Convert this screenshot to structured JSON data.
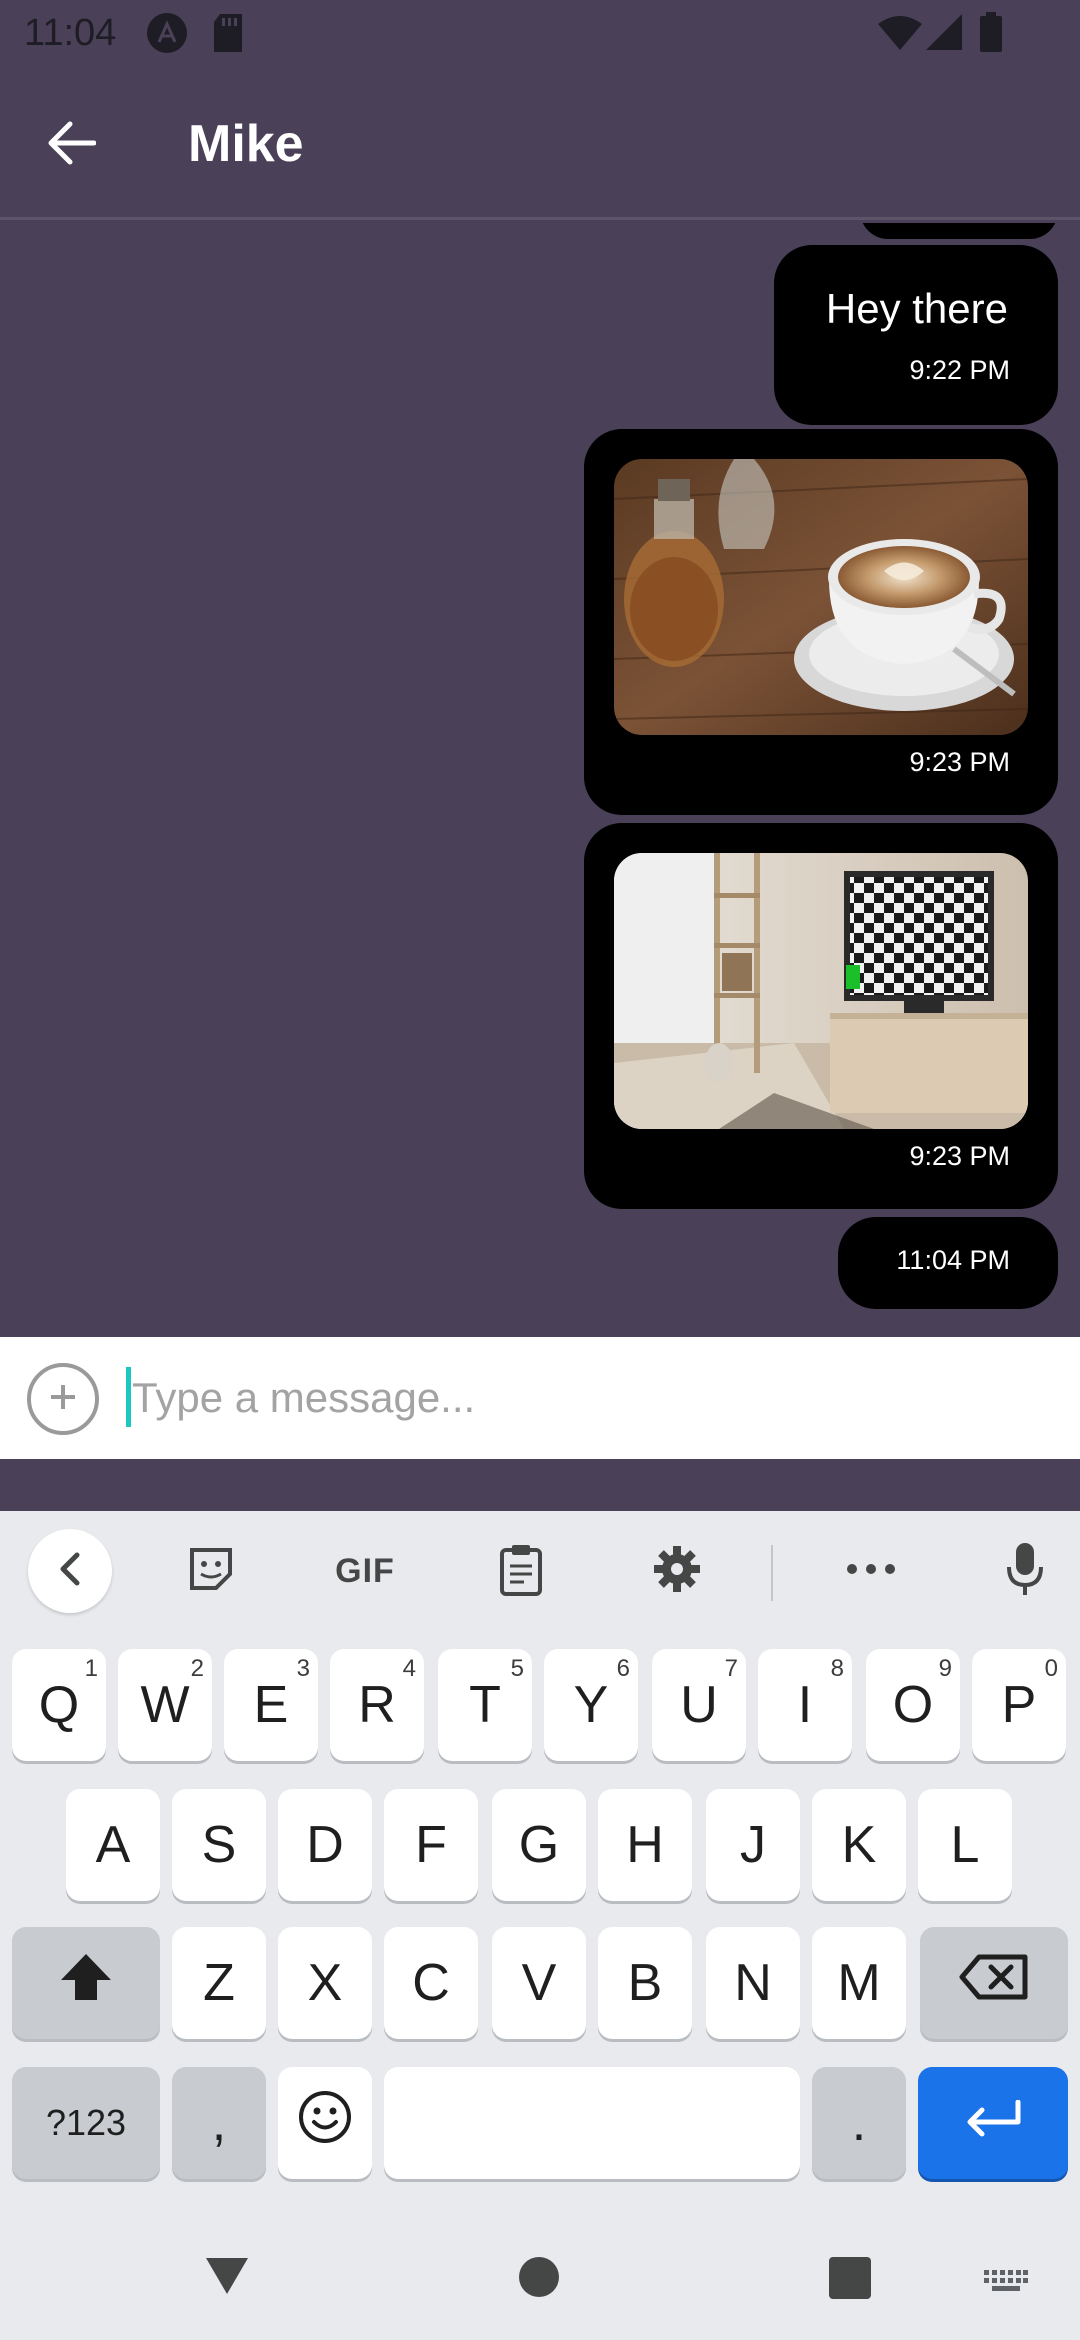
{
  "status_bar": {
    "time": "11:04",
    "icons": [
      "app-notification-icon",
      "sd-card-icon",
      "wifi-icon",
      "signal-icon",
      "battery-icon"
    ]
  },
  "app_bar": {
    "back_icon": "arrow-left-icon",
    "title": "Mike"
  },
  "messages": [
    {
      "type": "text",
      "text": "Hey there",
      "time": "9:22 PM"
    },
    {
      "type": "image",
      "image": "coffee-cup-photo",
      "time": "9:23 PM"
    },
    {
      "type": "image",
      "image": "room-tv-photo",
      "time": "9:23 PM"
    },
    {
      "type": "text",
      "text": "",
      "time": "11:04 PM"
    }
  ],
  "input": {
    "add_icon": "plus-circle-icon",
    "placeholder": "Type a message...",
    "value": ""
  },
  "keyboard": {
    "toolbar": {
      "back_icon": "chevron-left-icon",
      "sticker_icon": "sticker-icon",
      "gif_label": "GIF",
      "clipboard_icon": "clipboard-icon",
      "settings_icon": "gear-icon",
      "more_icon": "more-horizontal-icon",
      "mic_icon": "microphone-icon"
    },
    "row1": [
      {
        "label": "Q",
        "hint": "1"
      },
      {
        "label": "W",
        "hint": "2"
      },
      {
        "label": "E",
        "hint": "3"
      },
      {
        "label": "R",
        "hint": "4"
      },
      {
        "label": "T",
        "hint": "5"
      },
      {
        "label": "Y",
        "hint": "6"
      },
      {
        "label": "U",
        "hint": "7"
      },
      {
        "label": "I",
        "hint": "8"
      },
      {
        "label": "O",
        "hint": "9"
      },
      {
        "label": "P",
        "hint": "0"
      }
    ],
    "row2": [
      "A",
      "S",
      "D",
      "F",
      "G",
      "H",
      "J",
      "K",
      "L"
    ],
    "row3": [
      "Z",
      "X",
      "C",
      "V",
      "B",
      "N",
      "M"
    ],
    "shift_icon": "shift-icon",
    "backspace_icon": "backspace-icon",
    "symbols_label": "?123",
    "comma_label": ",",
    "emoji_icon": "emoji-icon",
    "period_label": ".",
    "enter_icon": "enter-icon"
  },
  "nav_bar": {
    "back_icon": "nav-back-triangle-icon",
    "home_icon": "nav-home-circle-icon",
    "recents_icon": "nav-recents-square-icon",
    "keyboard_icon": "keyboard-switch-icon"
  },
  "colors": {
    "background": "#4a4159",
    "bubble": "#000000",
    "accent_blue": "#1a73e8",
    "cursor": "#1ec6c2"
  }
}
